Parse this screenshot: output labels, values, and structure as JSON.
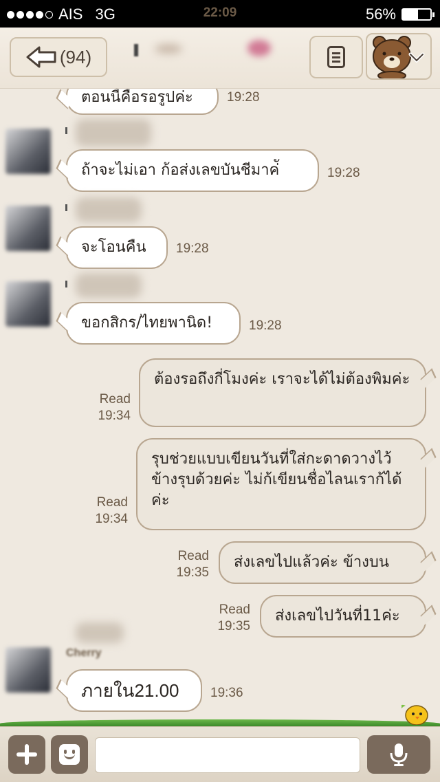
{
  "status_bar": {
    "carrier": "AIS",
    "network": "3G",
    "time": "22:09",
    "battery": "56%",
    "battery_level": 0.56
  },
  "header": {
    "back_count": "(94)"
  },
  "messages": [
    {
      "dir": "in",
      "text": "ตอนนี้คือรอรูปค่ะ",
      "time": "19:28"
    },
    {
      "dir": "in",
      "text": "ถ้าจะไม่เอา ก้อส่งเลขบันชีมาค่ั",
      "time": "19:28"
    },
    {
      "dir": "in",
      "text": "จะโอนคืน",
      "time": "19:28"
    },
    {
      "dir": "in",
      "text": "ขอกสิกร/ไทยพานิด!",
      "time": "19:28"
    },
    {
      "dir": "out",
      "text": "ต้องรอถึงกี่โมงค่ะ เราจะได้ไม่ต้องพิมค่ะ",
      "read": "Read",
      "time": "19:34"
    },
    {
      "dir": "out",
      "text": "รุบช่วยแบบเขียนวันที่ใส่กะดาดวางไว้ข้างรุบด้วยค่ะ ไม่ก้เขียนชื่อไลนเราก้ได้ค่ะ",
      "read": "Read",
      "time": "19:34"
    },
    {
      "dir": "out",
      "text": "ส่งเลขไปแล้วค่ะ ข้างบน",
      "read": "Read",
      "time": "19:35"
    },
    {
      "dir": "out",
      "text": "ส่งเลขไปวันที่11ค่ะ",
      "read": "Read",
      "time": "19:35"
    },
    {
      "dir": "in",
      "name": "Cherry",
      "text": "ภายใน21.00",
      "time": "19:36"
    }
  ],
  "icons": {
    "back": "back-arrow-icon",
    "menu": "menu-doc-icon",
    "sticker": "bear-sticker-icon",
    "plus": "plus-icon",
    "emoji": "emoji-icon",
    "mic": "microphone-icon"
  },
  "colors": {
    "background": "#efe9e0",
    "bubble_border": "#b8a690",
    "footer_button": "#7a6a5c"
  }
}
